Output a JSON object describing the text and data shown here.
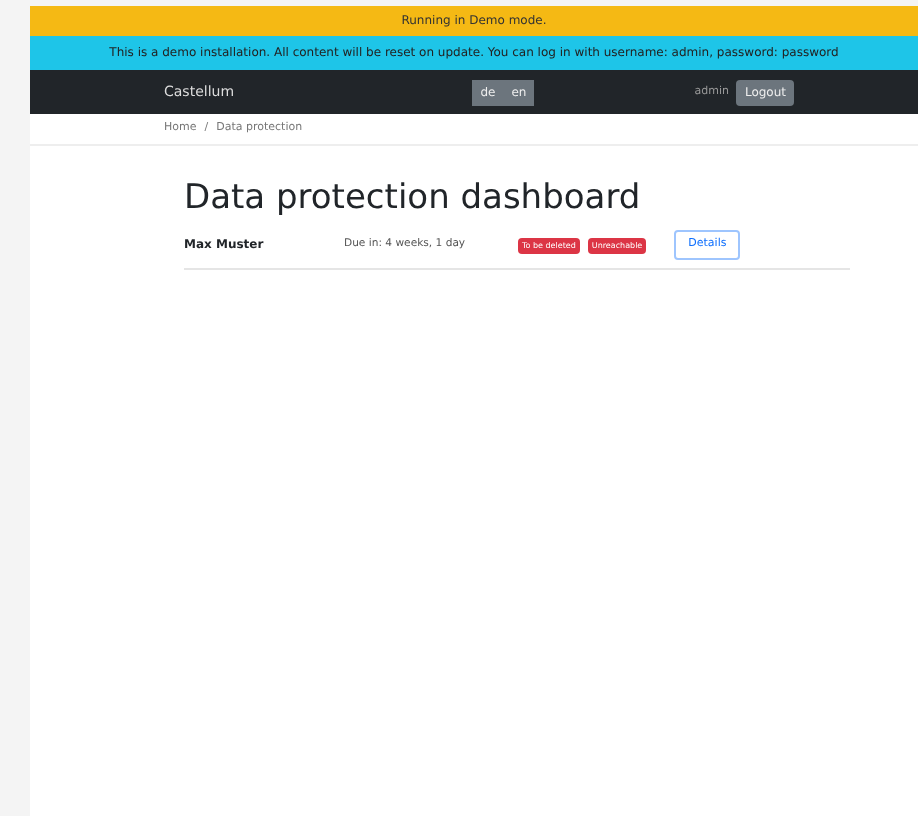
{
  "demo_banner": "Running in Demo mode.",
  "info_banner": "This is a demo installation. All content will be reset on update. You can log in with username: admin, password: password",
  "navbar": {
    "brand": "Castellum",
    "languages": [
      "de",
      "en"
    ],
    "user": "admin",
    "logout": "Logout"
  },
  "breadcrumb": {
    "items": [
      "Home",
      "Data protection"
    ],
    "separator": "/"
  },
  "heading": "Data protection dashboard",
  "rows": [
    {
      "name": "Max Muster",
      "due": "Due in: 4 weeks, 1 day",
      "badges": [
        "To be deleted",
        "Unreachable"
      ],
      "action": "Details"
    }
  ]
}
